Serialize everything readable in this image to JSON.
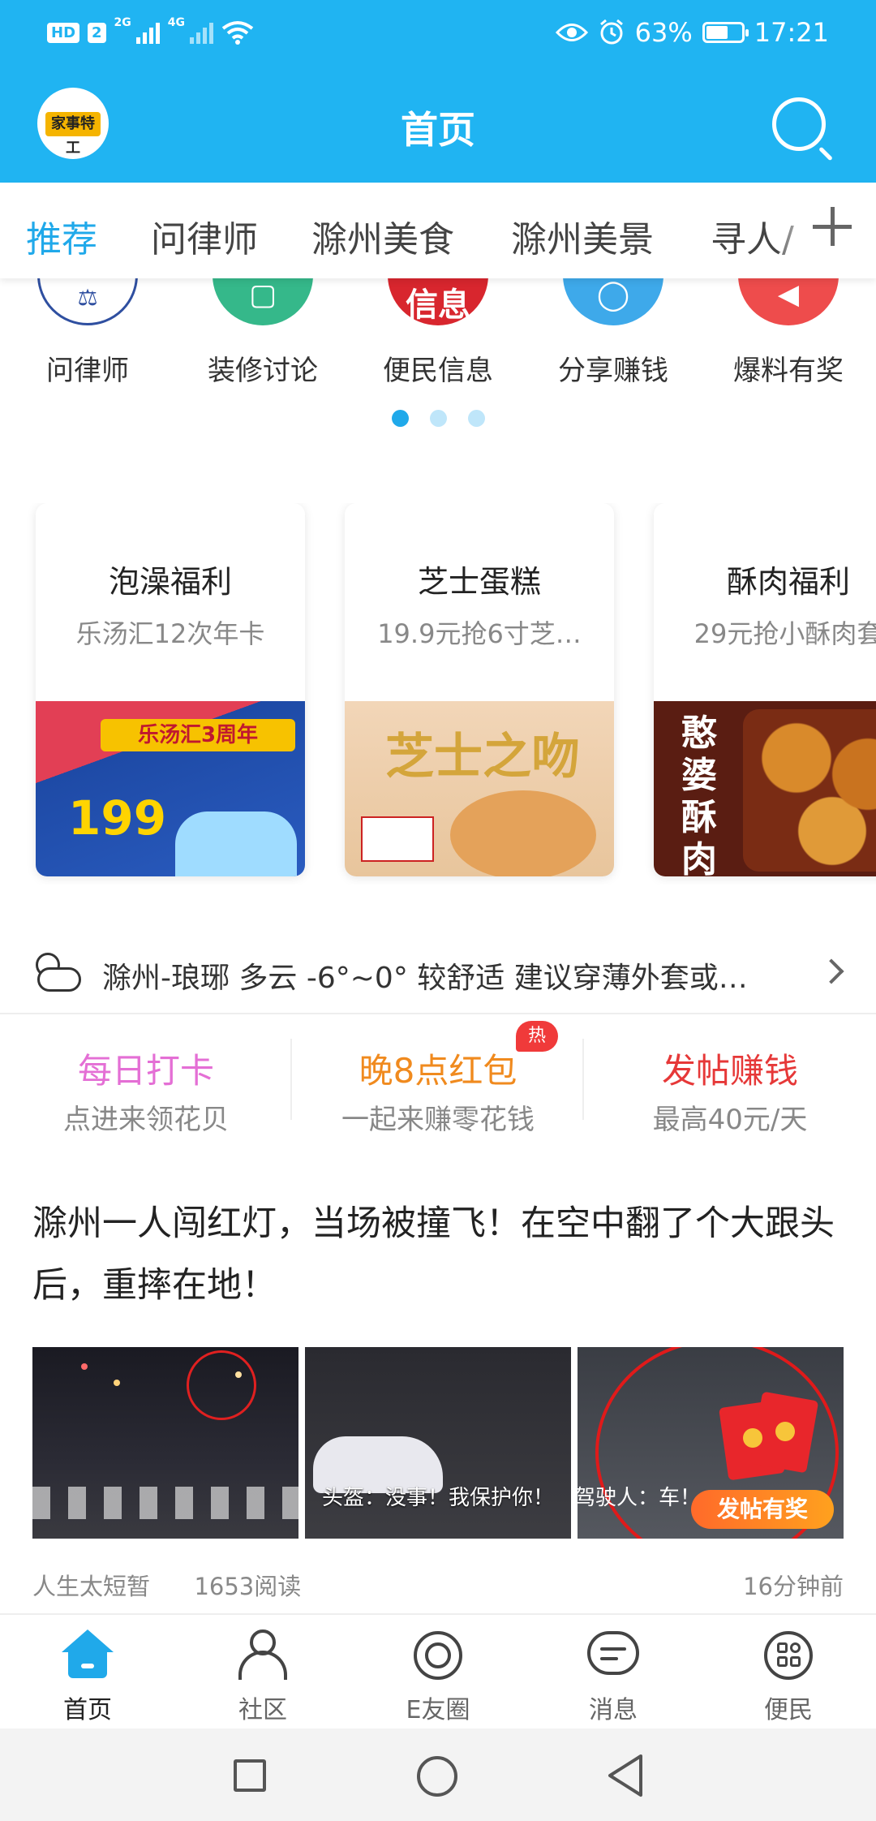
{
  "status_bar": {
    "hd": "HD",
    "sim1": "2",
    "net1": "2G",
    "net2": "4G",
    "battery_text": "63%",
    "battery_level": 0.63,
    "time": "17:21"
  },
  "app_bar": {
    "title": "首页",
    "logo_text": "家事特工"
  },
  "tabs": {
    "items": [
      "推荐",
      "问律师",
      "滁州美食",
      "滁州美景",
      "寻人/"
    ],
    "active_index": 0
  },
  "quick_icons": [
    {
      "label": "问律师",
      "icon": "lawyer-badge-icon",
      "color": "#2f4fa0",
      "glyph": ""
    },
    {
      "label": "装修讨论",
      "icon": "renovation-icon",
      "color": "#35b88a",
      "glyph": ""
    },
    {
      "label": "便民信息",
      "icon": "info-icon",
      "color": "#d8262e",
      "glyph": "信息"
    },
    {
      "label": "分享赚钱",
      "icon": "share-icon",
      "color": "#3ea9ea",
      "glyph": ""
    },
    {
      "label": "爆料有奖",
      "icon": "megaphone-icon",
      "color": "#ee4c4c",
      "glyph": ""
    }
  ],
  "pager": {
    "count": 3,
    "active": 0
  },
  "promos": [
    {
      "title": "泡澡福利",
      "subtitle": "乐汤汇12次年卡",
      "image_text": {
        "banner": "乐汤汇3周年",
        "price": "199"
      }
    },
    {
      "title": "芝士蛋糕",
      "subtitle": "19.9元抢6寸芝…",
      "image_text": {
        "word": "芝士之吻"
      }
    },
    {
      "title": "酥肉福利",
      "subtitle": "29元抢小酥肉套",
      "image_text": {
        "vertical": "憨婆酥肉"
      }
    }
  ],
  "weather": {
    "text": "滁州-琅琊 多云 -6°~0° 较舒适 建议穿薄外套或…",
    "icon": "partly-cloudy-icon"
  },
  "activities": [
    {
      "title": "每日打卡",
      "subtitle": "点进来领花贝",
      "color": "#e46fd5"
    },
    {
      "title": "晚8点红包",
      "subtitle": "一起来赚零花钱",
      "color": "#f08a1e",
      "badge": "热"
    },
    {
      "title": "发帖赚钱",
      "subtitle": "最高40元/天",
      "color": "#e63838"
    }
  ],
  "news": {
    "headline": "滁州一人闯红灯，当场被撞飞！在空中翻了个大跟头后，重摔在地！",
    "captions": [
      "头盔：没事！我保护你！",
      "驾驶人：车！"
    ],
    "author": "人生太短暂",
    "reads": "1653阅读",
    "time": "16分钟前",
    "promo_button": "发帖有奖"
  },
  "bottom_nav": {
    "items": [
      {
        "label": "首页",
        "icon": "home-icon"
      },
      {
        "label": "社区",
        "icon": "community-icon"
      },
      {
        "label": "E友圈",
        "icon": "friends-circle-icon"
      },
      {
        "label": "消息",
        "icon": "message-icon"
      },
      {
        "label": "便民",
        "icon": "services-icon"
      }
    ],
    "active_index": 0
  },
  "colors": {
    "brand": "#20b4f2",
    "accent": "#20a9ea",
    "hot": "#f03a3a"
  }
}
